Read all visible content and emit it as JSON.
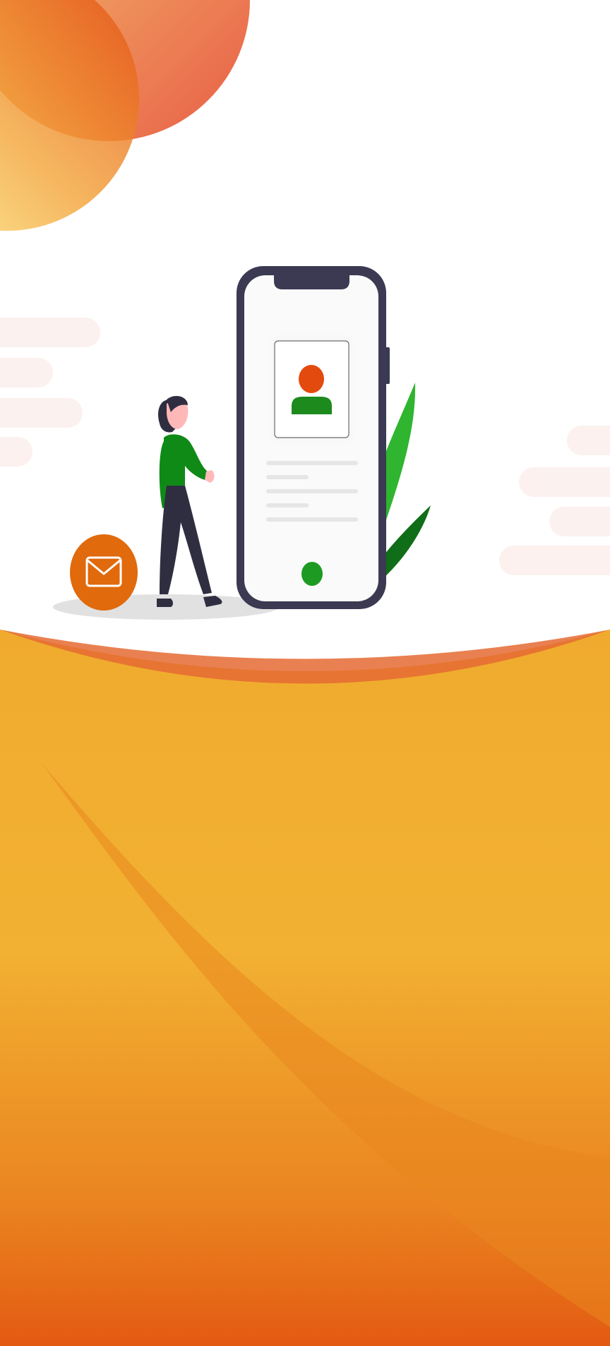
{
  "screen": {
    "name": "onboarding-splash",
    "illustration": "person-standing-beside-phone-with-profile-card"
  },
  "icons": {
    "mail": "envelope-icon",
    "profile": "user-avatar-icon",
    "leaf": "leaf-icon"
  },
  "colors": {
    "background": "#ffffff",
    "orange_light": "#f2b132",
    "orange_mid": "#f0a02a",
    "orange_dark": "#e35a12",
    "accent_red": "#e24a0e",
    "brand_green": "#1d8a1d",
    "leaf_green_light": "#2fb52f",
    "leaf_green_dark": "#0f6e17",
    "phone_frame": "#3b3a52",
    "mail_badge": "#e06a0c",
    "shadow_grey": "#e3e3e3",
    "line_grey": "#e6e6e6"
  }
}
